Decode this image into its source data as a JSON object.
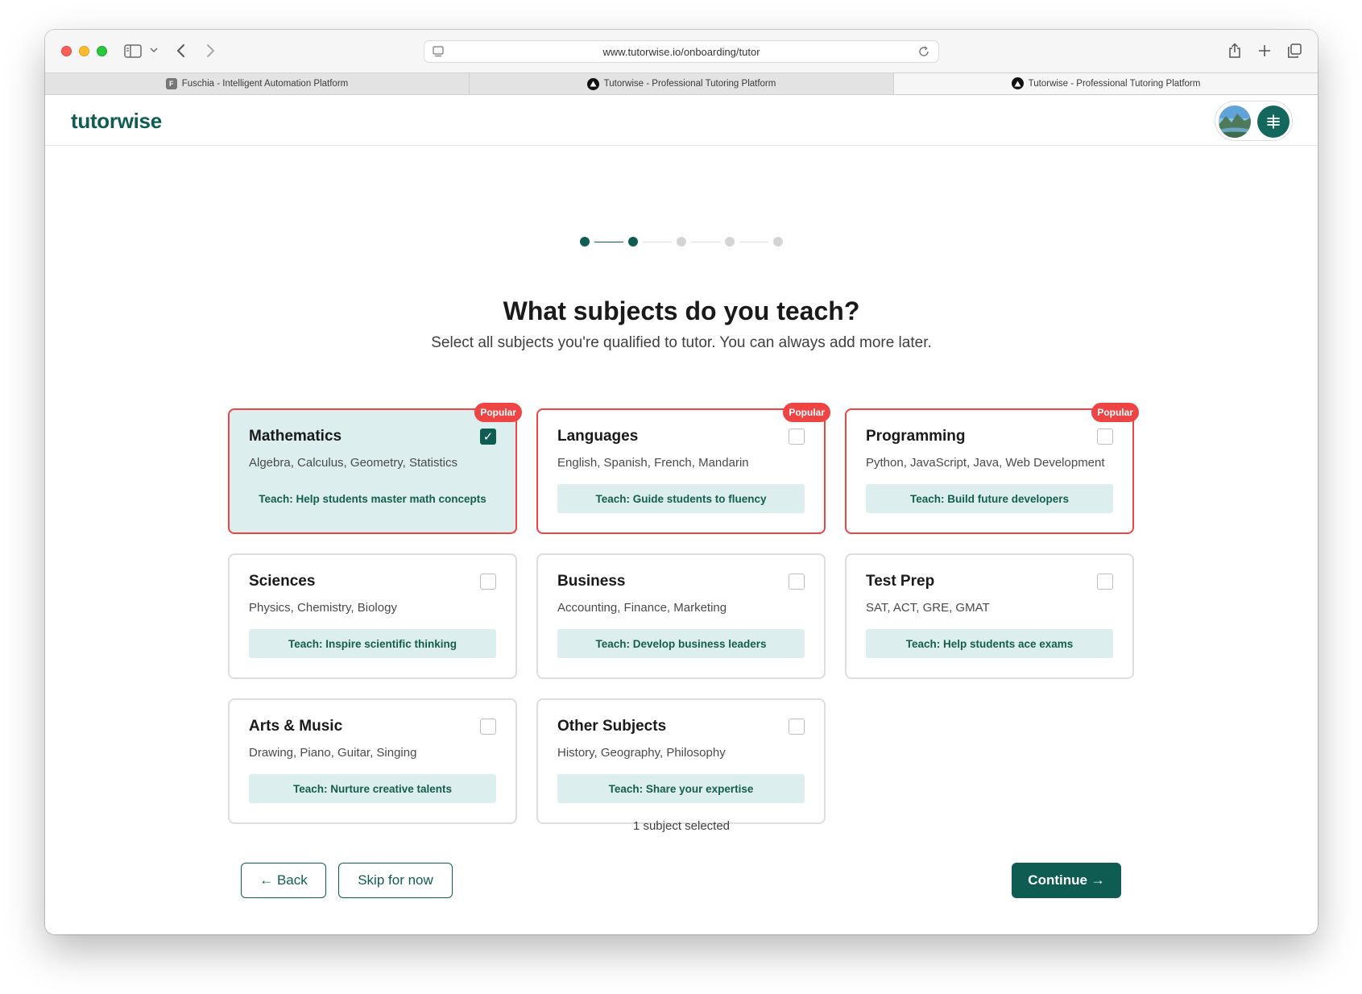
{
  "browser": {
    "url": "www.tutorwise.io/onboarding/tutor",
    "tabs": [
      {
        "label": "Fuschia - Intelligent Automation Platform",
        "favicon": "F"
      },
      {
        "label": "Tutorwise - Professional Tutoring Platform"
      },
      {
        "label": "Tutorwise - Professional Tutoring Platform"
      }
    ]
  },
  "app": {
    "logo": "tutorwise"
  },
  "stepper": {
    "total": 5,
    "current": 2
  },
  "header": {
    "title": "What subjects do you teach?",
    "subtitle": "Select all subjects you're qualified to tutor. You can always add more later."
  },
  "subjects": [
    {
      "title": "Mathematics",
      "desc": "Algebra, Calculus, Geometry, Statistics",
      "teach": "Teach: Help students master math concepts",
      "badge": "Popular",
      "checked": true
    },
    {
      "title": "Languages",
      "desc": "English, Spanish, French, Mandarin",
      "teach": "Teach: Guide students to fluency",
      "badge": "Popular",
      "checked": false
    },
    {
      "title": "Programming",
      "desc": "Python, JavaScript, Java, Web Development",
      "teach": "Teach: Build future developers",
      "badge": "Popular",
      "checked": false
    },
    {
      "title": "Sciences",
      "desc": "Physics, Chemistry, Biology",
      "teach": "Teach: Inspire scientific thinking",
      "checked": false
    },
    {
      "title": "Business",
      "desc": "Accounting, Finance, Marketing",
      "teach": "Teach: Develop business leaders",
      "checked": false
    },
    {
      "title": "Test Prep",
      "desc": "SAT, ACT, GRE, GMAT",
      "teach": "Teach: Help students ace exams",
      "checked": false
    },
    {
      "title": "Arts & Music",
      "desc": "Drawing, Piano, Guitar, Singing",
      "teach": "Teach: Nurture creative talents",
      "checked": false
    },
    {
      "title": "Other Subjects",
      "desc": "History, Geography, Philosophy",
      "teach": "Teach: Share your expertise",
      "checked": false
    }
  ],
  "selection_count": "1 subject selected",
  "actions": {
    "back": "← Back",
    "skip": "Skip for now",
    "continue": "Continue →"
  },
  "colors": {
    "brand": "#0f5c52",
    "popular": "#ef4444",
    "selected_bg": "#dceeed"
  }
}
